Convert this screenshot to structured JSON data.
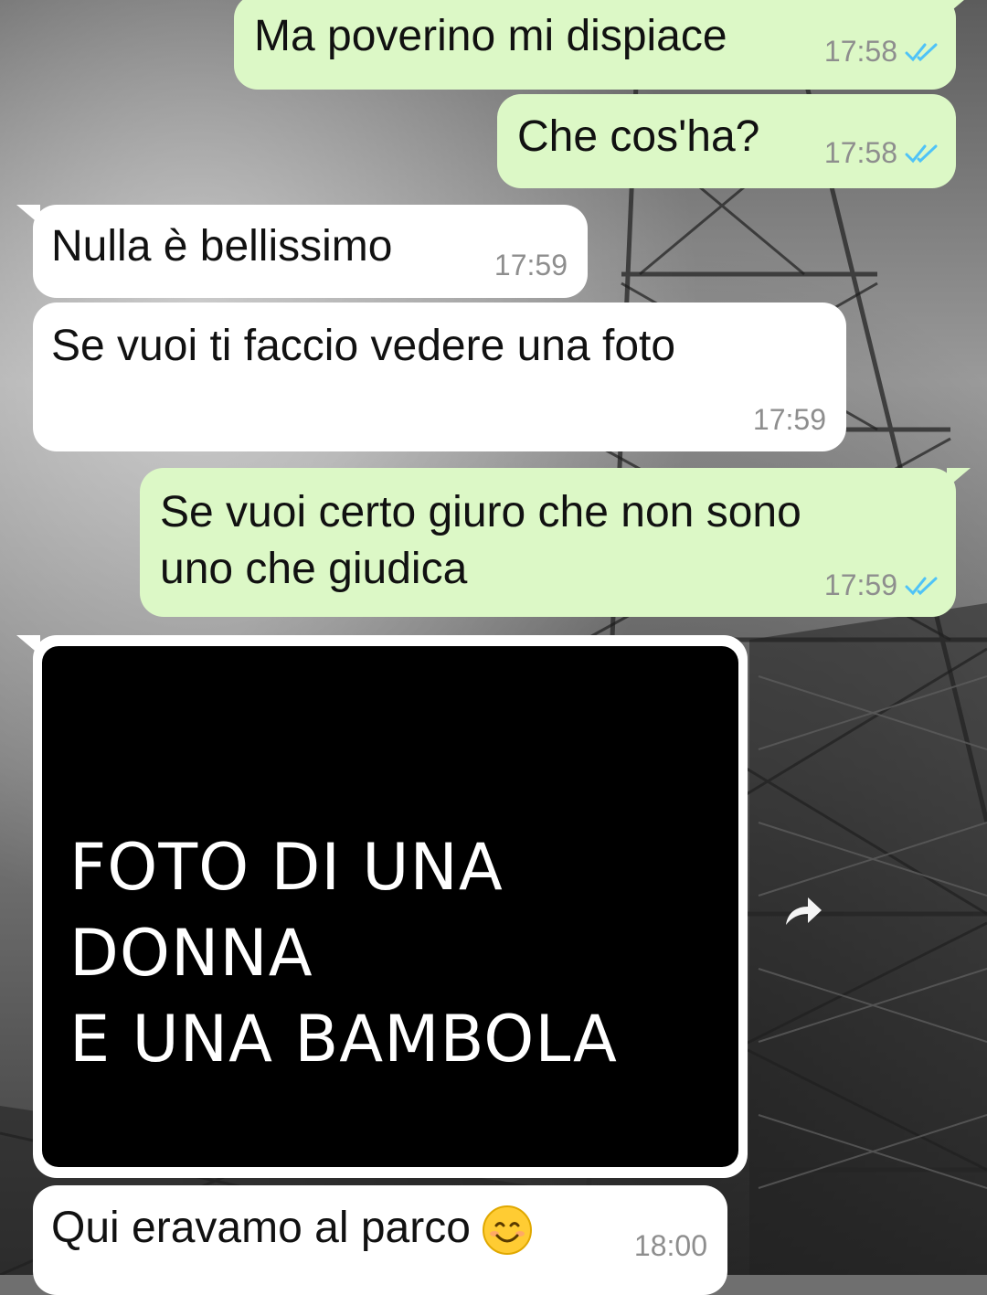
{
  "messages": [
    {
      "text": "Ma poverino mi dispiace",
      "time": "17:58"
    },
    {
      "text": "Che cos'ha?",
      "time": "17:58"
    },
    {
      "text": "Nulla è bellissimo",
      "time": "17:59"
    },
    {
      "text": "Se vuoi ti faccio vedere una foto",
      "time": "17:59"
    },
    {
      "line1": "Se vuoi certo giuro che non sono",
      "line2": "uno che giudica",
      "time": "17:59"
    },
    {
      "caption_line1": "FOTO DI UNA DONNA",
      "caption_line2": "E UNA BAMBOLA"
    },
    {
      "text": "Qui eravamo al parco",
      "time": "18:00",
      "emoji": "smiling-face-emoji"
    }
  ],
  "icons": {
    "read_receipt": "double-check-icon",
    "forward": "forward-icon"
  },
  "colors": {
    "outgoing_bubble": "#dcf8c6",
    "incoming_bubble": "#ffffff",
    "read_ticks": "#4fc3f7",
    "time_text": "#8e8e8e",
    "photo_background": "#000000"
  }
}
